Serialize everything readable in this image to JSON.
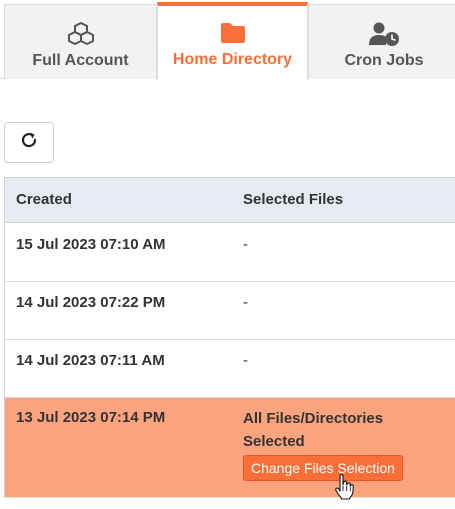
{
  "tabs": [
    {
      "label": "Full Account",
      "icon": "cubes-icon",
      "active": false
    },
    {
      "label": "Home Directory",
      "icon": "folder-icon",
      "active": true
    },
    {
      "label": "Cron Jobs",
      "icon": "user-clock-icon",
      "active": false
    }
  ],
  "refresh": {
    "icon": "refresh-icon"
  },
  "table": {
    "headers": [
      "Created",
      "Selected Files"
    ],
    "rows": [
      {
        "created": "15 Jul 2023 07:10 AM",
        "files": "-"
      },
      {
        "created": "14 Jul 2023 07:22 PM",
        "files": "-"
      },
      {
        "created": "14 Jul 2023 07:11 AM",
        "files": "-"
      },
      {
        "created": "13 Jul 2023 07:14 PM",
        "files": "All Files/Directories Selected",
        "action": "Change Files Selection",
        "selected": true
      }
    ]
  },
  "colors": {
    "accent": "#fa6e37",
    "selected_row": "#fda47e",
    "header_bg": "#e7ebf1",
    "icon_gray": "#555555"
  }
}
